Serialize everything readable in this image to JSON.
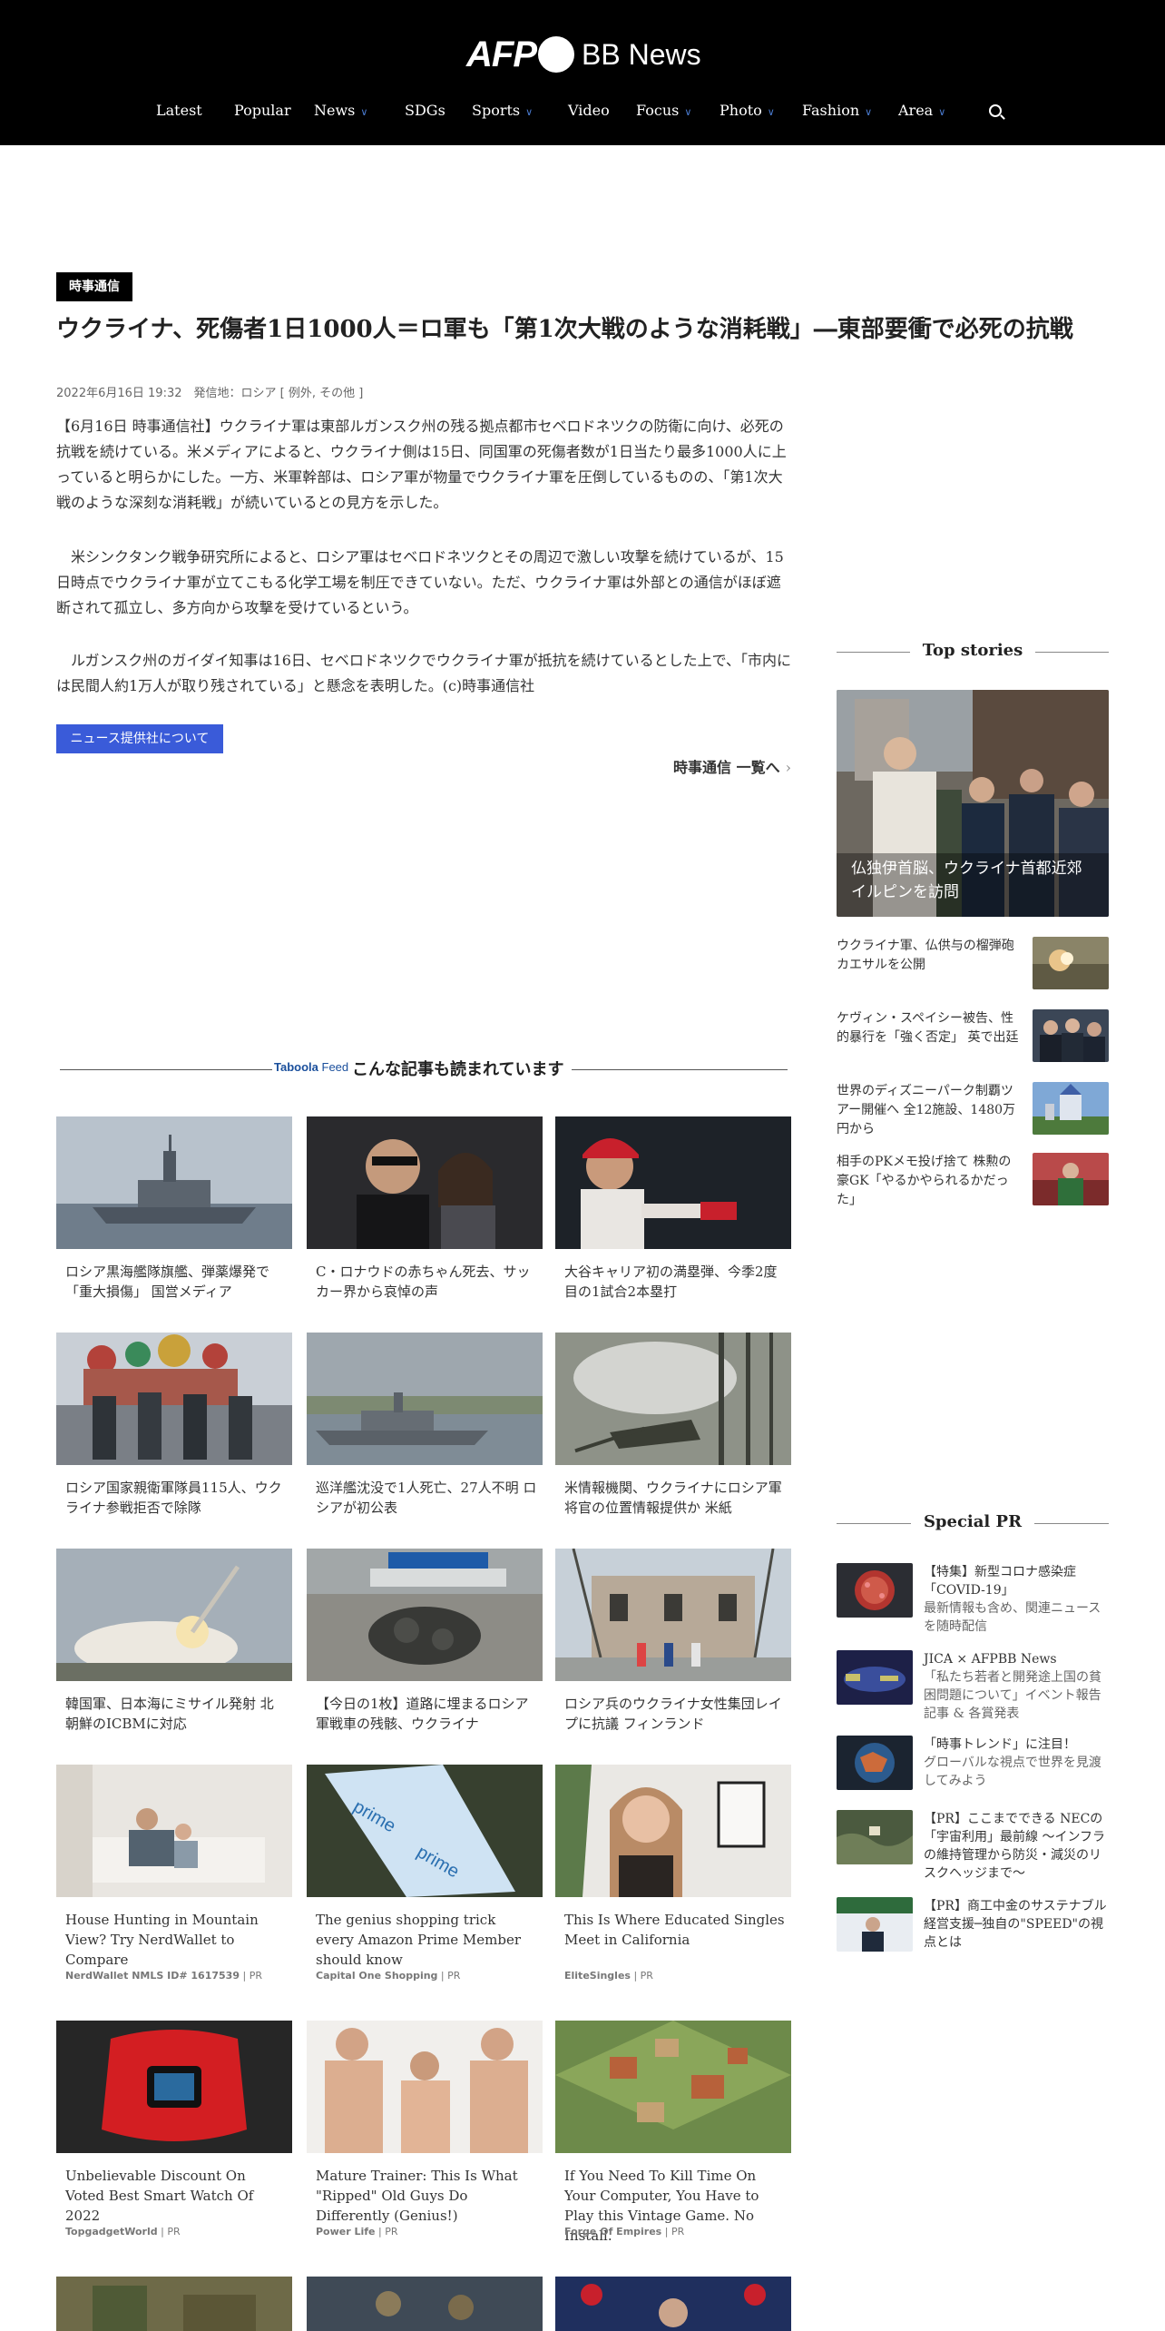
{
  "header": {
    "logo_afp": "AFP",
    "logo_bb": "BB News",
    "nav": [
      {
        "label": "Latest",
        "has_dropdown": false
      },
      {
        "label": "Popular",
        "has_dropdown": false
      },
      {
        "label": "News",
        "has_dropdown": true
      },
      {
        "label": "SDGs",
        "has_dropdown": false
      },
      {
        "label": "Sports",
        "has_dropdown": true
      },
      {
        "label": "Video",
        "has_dropdown": false
      },
      {
        "label": "Focus",
        "has_dropdown": true
      },
      {
        "label": "Photo",
        "has_dropdown": true
      },
      {
        "label": "Fashion",
        "has_dropdown": true
      },
      {
        "label": "Area",
        "has_dropdown": true
      }
    ]
  },
  "article": {
    "badge": "時事通信",
    "title": "ウクライナ、死傷者1日1000人＝ロ軍も「第1次大戦のような消耗戦」―東部要衝で必死の抗戦",
    "meta": "2022年6月16日 19:32　発信地：ロシア [ 例外, その他 ]",
    "paragraphs": [
      "【6月16日 時事通信社】ウクライナ軍は東部ルガンスク州の残る拠点都市セベロドネツクの防衛に向け、必死の抗戦を続けている。米メディアによると、ウクライナ側は15日、同国軍の死傷者数が1日当たり最多1000人に上っていると明らかにした。一方、米軍幹部は、ロシア軍が物量でウクライナ軍を圧倒しているものの、「第1次大戦のような深刻な消耗戦」が続いているとの見方を示した。",
      "　米シンクタンク戦争研究所によると、ロシア軍はセベロドネツクとその周辺で激しい攻撃を続けているが、15日時点でウクライナ軍が立てこもる化学工場を制圧できていない。ただ、ウクライナ軍は外部との通信がほぼ遮断されて孤立し、多方向から攻撃を受けているという。",
      "　ルガンスク州のガイダイ知事は16日、セベロドネツクでウクライナ軍が抵抗を続けているとした上で、「市内には民間人約1万人が取り残されている」と懸念を表明した。(c)時事通信社"
    ],
    "provider_button": "ニュース提供社について",
    "list_link": "時事通信 一覧へ"
  },
  "sidebar": {
    "top_stories_heading": "Top stories",
    "top_main_caption": "仏独伊首脳、ウクライナ首都近郊イルピンを訪問",
    "top_items": [
      "ウクライナ軍、仏供与の榴弾砲カエサルを公開",
      "ケヴィン・スペイシー被告、性的暴行を「強く否定」 英で出廷",
      "世界のディズニーパーク制覇ツアー開催へ 全12施設、1480万円から",
      "相手のPKメモ投げ捨て 株勲の豪GK「やるかやられるかだった」"
    ],
    "special_pr_heading": "Special PR",
    "pr_items": [
      {
        "title": "【特集】新型コロナ感染症「COVID-19」",
        "sub": "最新情報も含め、関連ニュースを随時配信"
      },
      {
        "title": "JICA × AFPBB News",
        "sub": "「私たち若者と開発途上国の貧困問題について」イベント報告記事 & 各賞発表"
      },
      {
        "title": "「時事トレンド」に注目！",
        "sub": "グローバルな視点で世界を見渡してみよう"
      },
      {
        "title": "【PR】ここまでできる NECの「宇宙利用」最前線 ～インフラの維持管理から防災・減災のリスクヘッジまで～",
        "sub": ""
      },
      {
        "title": "【PR】商工中金のサステナブル経営支援─独自の\"SPEED\"の視点とは",
        "sub": ""
      }
    ]
  },
  "feed": {
    "brand": "Taboola",
    "brand_suffix": "Feed",
    "heading": "こんな記事も読まれています",
    "cards": [
      {
        "caption": "ロシア黒海艦隊旗艦、弾薬爆発で「重大損傷」 国営メディア",
        "source": ""
      },
      {
        "caption": "C・ロナウドの赤ちゃん死去、サッカー界から哀悼の声",
        "source": ""
      },
      {
        "caption": "大谷キャリア初の満塁弾、今季2度目の1試合2本塁打",
        "source": ""
      },
      {
        "caption": "ロシア国家親衛軍隊員115人、ウクライナ参戦拒否で除隊",
        "source": ""
      },
      {
        "caption": "巡洋艦沈没で1人死亡、27人不明 ロシアが初公表",
        "source": ""
      },
      {
        "caption": "米情報機関、ウクライナにロシア軍将官の位置情報提供か 米紙",
        "source": ""
      },
      {
        "caption": "韓国軍、日本海にミサイル発射 北朝鮮のICBMに対応",
        "source": ""
      },
      {
        "caption": "【今日の1枚】道路に埋まるロシア軍戦車の残骸、ウクライナ",
        "source": ""
      },
      {
        "caption": "ロシア兵のウクライナ女性集団レイプに抗議 フィンランド",
        "source": ""
      },
      {
        "caption": "House Hunting in Mountain View? Try NerdWallet to Compare",
        "source": "NerdWallet NMLS ID# 1617539",
        "tag": "PR"
      },
      {
        "caption": "The genius shopping trick every Amazon Prime Member should know",
        "source": "Capital One Shopping",
        "tag": "PR"
      },
      {
        "caption": "This Is Where Educated Singles Meet in California",
        "source": "EliteSingles",
        "tag": "PR"
      },
      {
        "caption": "Unbelievable Discount On Voted Best Smart Watch Of 2022",
        "source": "TopgadgetWorld",
        "tag": "PR"
      },
      {
        "caption": "Mature Trainer: This Is What \"Ripped\" Old Guys Do Differently (Genius!)",
        "source": "Power Life",
        "tag": "PR"
      },
      {
        "caption": "If You Need To Kill Time On Your Computer, You Have to Play this Vintage Game. No Install.",
        "source": "Forge Of Empires",
        "tag": "PR"
      }
    ]
  }
}
